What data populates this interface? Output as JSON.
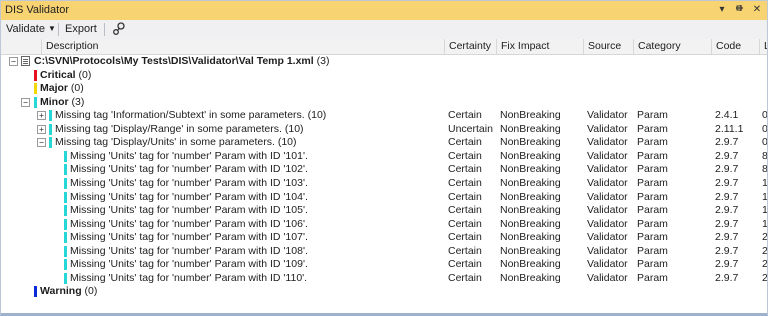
{
  "window": {
    "title": "DIS Validator",
    "pin_icon": "pin-icon",
    "close_icon": "close-icon",
    "dropdown_icon": "dropdown-icon"
  },
  "toolbar": {
    "validate_label": "Validate",
    "export_label": "Export",
    "settings_icon": "link-settings-icon"
  },
  "columns": {
    "description": "Description",
    "certainty": "Certainty",
    "fix_impact": "Fix Impact",
    "source": "Source",
    "category": "Category",
    "code": "Code",
    "extra": "L"
  },
  "colors": {
    "critical": "#e81123",
    "major": "#f2d900",
    "minor": "#27d6d6",
    "warning": "#0a2bd6",
    "titlebar": "#f7d372"
  },
  "rows": [
    {
      "level": 0,
      "expander": "−",
      "icon": "file-icon",
      "desc": "C:\\SVN\\Protocols\\My Tests\\DIS\\Validator\\Val Temp 1.xml",
      "count": "(3)",
      "bold": true
    },
    {
      "level": 1,
      "sev": "critical",
      "desc": "Critical",
      "count": "(0)",
      "bold": true
    },
    {
      "level": 1,
      "sev": "major",
      "desc": "Major",
      "count": "(0)",
      "bold": true
    },
    {
      "level": 1,
      "expander": "−",
      "sev": "minor",
      "desc": "Minor",
      "count": "(3)",
      "bold": true
    },
    {
      "level": 2,
      "expander": "+",
      "sev": "minor",
      "desc": "Missing tag 'Information/Subtext' in some parameters.",
      "count": "(10)",
      "certainty": "Certain",
      "impact": "NonBreaking",
      "source": "Validator",
      "category": "Param",
      "code": "2.4.1",
      "extra": "0"
    },
    {
      "level": 2,
      "expander": "+",
      "sev": "minor",
      "desc": "Missing tag 'Display/Range' in some parameters.",
      "count": "(10)",
      "certainty": "Uncertain",
      "impact": "NonBreaking",
      "source": "Validator",
      "category": "Param",
      "code": "2.11.1",
      "extra": "0"
    },
    {
      "level": 2,
      "expander": "−",
      "sev": "minor",
      "desc": "Missing tag 'Display/Units' in some parameters.",
      "count": "(10)",
      "certainty": "Certain",
      "impact": "NonBreaking",
      "source": "Validator",
      "category": "Param",
      "code": "2.9.7",
      "extra": "0"
    },
    {
      "level": 3,
      "sev": "minor",
      "desc": "Missing 'Units' tag for 'number' Param with ID '101'.",
      "certainty": "Certain",
      "impact": "NonBreaking",
      "source": "Validator",
      "category": "Param",
      "code": "2.9.7",
      "extra": "8"
    },
    {
      "level": 3,
      "sev": "minor",
      "desc": "Missing 'Units' tag for 'number' Param with ID '102'.",
      "certainty": "Certain",
      "impact": "NonBreaking",
      "source": "Validator",
      "category": "Param",
      "code": "2.9.7",
      "extra": "8"
    },
    {
      "level": 3,
      "sev": "minor",
      "desc": "Missing 'Units' tag for 'number' Param with ID '103'.",
      "certainty": "Certain",
      "impact": "NonBreaking",
      "source": "Validator",
      "category": "Param",
      "code": "2.9.7",
      "extra": "1"
    },
    {
      "level": 3,
      "sev": "minor",
      "desc": "Missing 'Units' tag for 'number' Param with ID '104'.",
      "certainty": "Certain",
      "impact": "NonBreaking",
      "source": "Validator",
      "category": "Param",
      "code": "2.9.7",
      "extra": "1"
    },
    {
      "level": 3,
      "sev": "minor",
      "desc": "Missing 'Units' tag for 'number' Param with ID '105'.",
      "certainty": "Certain",
      "impact": "NonBreaking",
      "source": "Validator",
      "category": "Param",
      "code": "2.9.7",
      "extra": "1"
    },
    {
      "level": 3,
      "sev": "minor",
      "desc": "Missing 'Units' tag for 'number' Param with ID '106'.",
      "certainty": "Certain",
      "impact": "NonBreaking",
      "source": "Validator",
      "category": "Param",
      "code": "2.9.7",
      "extra": "1"
    },
    {
      "level": 3,
      "sev": "minor",
      "desc": "Missing 'Units' tag for 'number' Param with ID '107'.",
      "certainty": "Certain",
      "impact": "NonBreaking",
      "source": "Validator",
      "category": "Param",
      "code": "2.9.7",
      "extra": "2"
    },
    {
      "level": 3,
      "sev": "minor",
      "desc": "Missing 'Units' tag for 'number' Param with ID '108'.",
      "certainty": "Certain",
      "impact": "NonBreaking",
      "source": "Validator",
      "category": "Param",
      "code": "2.9.7",
      "extra": "2"
    },
    {
      "level": 3,
      "sev": "minor",
      "desc": "Missing 'Units' tag for 'number' Param with ID '109'.",
      "certainty": "Certain",
      "impact": "NonBreaking",
      "source": "Validator",
      "category": "Param",
      "code": "2.9.7",
      "extra": "2"
    },
    {
      "level": 3,
      "sev": "minor",
      "desc": "Missing 'Units' tag for 'number' Param with ID '110'.",
      "certainty": "Certain",
      "impact": "NonBreaking",
      "source": "Validator",
      "category": "Param",
      "code": "2.9.7",
      "extra": "2"
    },
    {
      "level": 1,
      "sev": "warning",
      "desc": "Warning",
      "count": "(0)",
      "bold": true
    }
  ]
}
